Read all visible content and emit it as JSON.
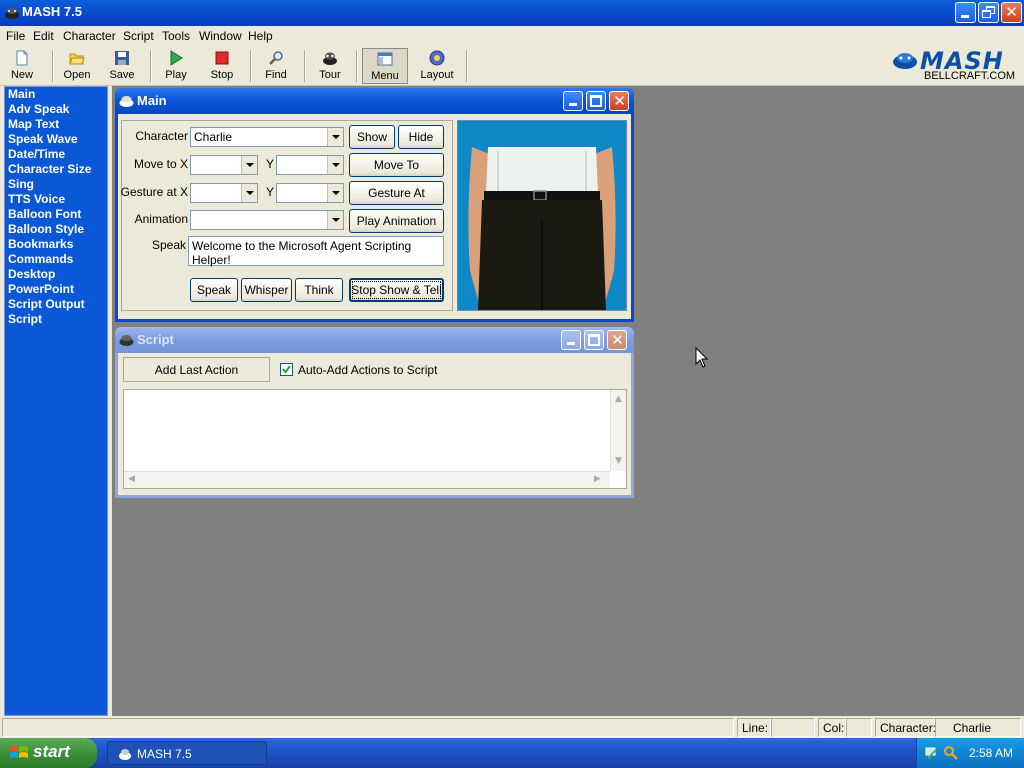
{
  "app": {
    "title": "MASH 7.5",
    "logo_text": "MASH",
    "logo_subtext": "BELLCRAFT.COM"
  },
  "menu": [
    "File",
    "Edit",
    "Character",
    "Script",
    "Tools",
    "Window",
    "Help"
  ],
  "toolbar": {
    "new": "New",
    "open": "Open",
    "save": "Save",
    "play": "Play",
    "stop": "Stop",
    "find": "Find",
    "tour": "Tour",
    "menu": "Menu",
    "layout": "Layout"
  },
  "sidebar": {
    "items": [
      "Main",
      "Adv Speak",
      "Map Text",
      "Speak Wave",
      "Date/Time",
      "Character Size",
      "Sing",
      "TTS Voice",
      "Balloon Font",
      "Balloon Style",
      "Bookmarks",
      "Commands",
      "Desktop",
      "PowerPoint",
      "Script Output",
      "Script"
    ],
    "selected": "Main"
  },
  "main_window": {
    "title": "Main",
    "character_label": "Character",
    "character_value": "Charlie",
    "show_button": "Show",
    "hide_button": "Hide",
    "move_to_label": "Move to X",
    "y_label": "Y",
    "move_to_button": "Move To",
    "gesture_at_label": "Gesture at X",
    "gesture_at_button": "Gesture At",
    "animation_label": "Animation",
    "animation_value": "",
    "play_animation_button": "Play Animation",
    "speak_label": "Speak",
    "speak_text": "Welcome to the Microsoft Agent Scripting Helper!",
    "speak_button": "Speak",
    "whisper_button": "Whisper",
    "think_button": "Think",
    "stop_show_tell_button": "Stop Show & Tell"
  },
  "script_window": {
    "title": "Script",
    "add_last_action_button": "Add Last Action",
    "auto_add_label": "Auto-Add Actions to Script",
    "auto_add_checked": true,
    "script_text": ""
  },
  "statusbar": {
    "line_label": "Line:",
    "line_value": "",
    "col_label": "Col:",
    "col_value": "",
    "character_label": "Character:",
    "character_value": "Charlie"
  },
  "taskbar": {
    "start_label": "start",
    "task_label": "MASH 7.5",
    "clock": "2:58 AM"
  },
  "colors": {
    "title_blue": "#0a4fd0",
    "sidebar_blue": "#0a58d6",
    "mdi_gray": "#808080",
    "preview_bg": "#0e88c6",
    "taskbar_blue": "#245edb",
    "start_green": "#3c8f3a"
  }
}
